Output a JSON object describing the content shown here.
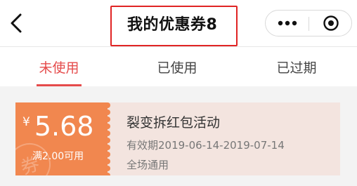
{
  "header": {
    "title": "我的优惠券8",
    "back_icon": "chevron-left-icon",
    "more_icon": "more-dots-icon",
    "target_icon": "target-circle-icon"
  },
  "tabs": [
    {
      "label": "未使用",
      "active": true
    },
    {
      "label": "已使用",
      "active": false
    },
    {
      "label": "已过期",
      "active": false
    }
  ],
  "coupon": {
    "currency": "¥",
    "amount": "5.68",
    "condition": "满2.00可用",
    "watermark": "券",
    "name": "裂变拆红包活动",
    "validity": "有效期2019-06-14-2019-07-14",
    "scope": "全场通用"
  },
  "colors": {
    "accent": "#e54b4b",
    "highlight_border": "#e02424",
    "coupon_left": "#f1874f",
    "coupon_bg": "#f3e4df",
    "page_bg": "#f3f3f3"
  }
}
